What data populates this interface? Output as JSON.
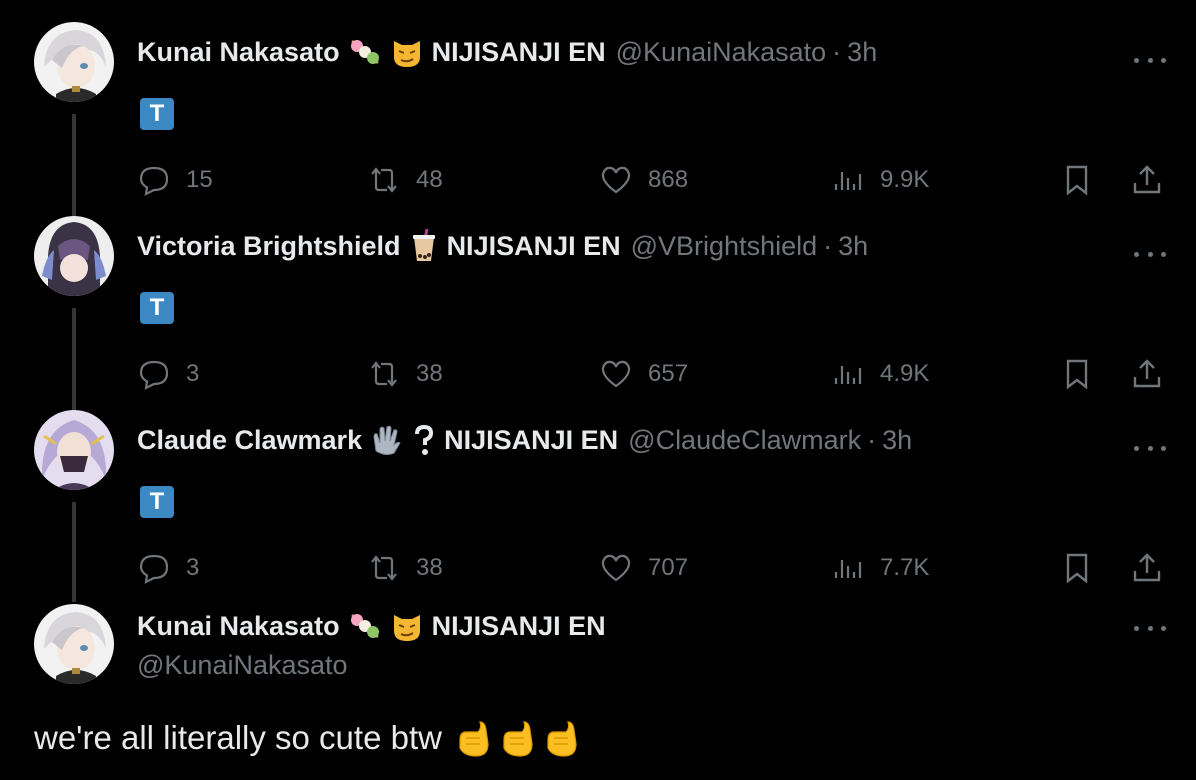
{
  "thread": [
    {
      "name": "Kunai Nakasato",
      "emoji_icons": [
        "dango-icon",
        "cat-face-icon"
      ],
      "org": "NIJISANJI EN",
      "handle": "@KunaiNakasato",
      "separator": "·",
      "time": "3h",
      "badge": "T",
      "stats": {
        "replies": "15",
        "retweets": "48",
        "likes": "868",
        "views": "9.9K"
      }
    },
    {
      "name": "Victoria Brightshield",
      "emoji_icons": [
        "bubble-tea-icon"
      ],
      "org": "NIJISANJI EN",
      "handle": "@VBrightshield",
      "separator": "·",
      "time": "3h",
      "badge": "T",
      "stats": {
        "replies": "3",
        "retweets": "38",
        "likes": "657",
        "views": "4.9K"
      }
    },
    {
      "name": "Claude Clawmark",
      "emoji_icons": [
        "glove-icon",
        "question-mark-icon"
      ],
      "org": "NIJISANJI EN",
      "handle": "@ClaudeClawmark",
      "separator": "·",
      "time": "3h",
      "badge": "T",
      "stats": {
        "replies": "3",
        "retweets": "38",
        "likes": "707",
        "views": "7.7K"
      }
    }
  ],
  "main_tweet": {
    "name": "Kunai Nakasato",
    "emoji_icons": [
      "dango-icon",
      "cat-face-icon"
    ],
    "org": "NIJISANJI EN",
    "handle": "@KunaiNakasato",
    "text": "we're all literally so cute btw",
    "trailing_emoji_icons": [
      "hand-with-index-finger-and-thumb-crossed-icon",
      "hand-with-index-finger-and-thumb-crossed-icon",
      "hand-with-index-finger-and-thumb-crossed-icon"
    ]
  },
  "colors": {
    "background": "#000000",
    "text_primary": "#e7e9ea",
    "text_secondary": "#71767b",
    "badge_blue": "#3b88c3",
    "thread_line": "#333639"
  }
}
